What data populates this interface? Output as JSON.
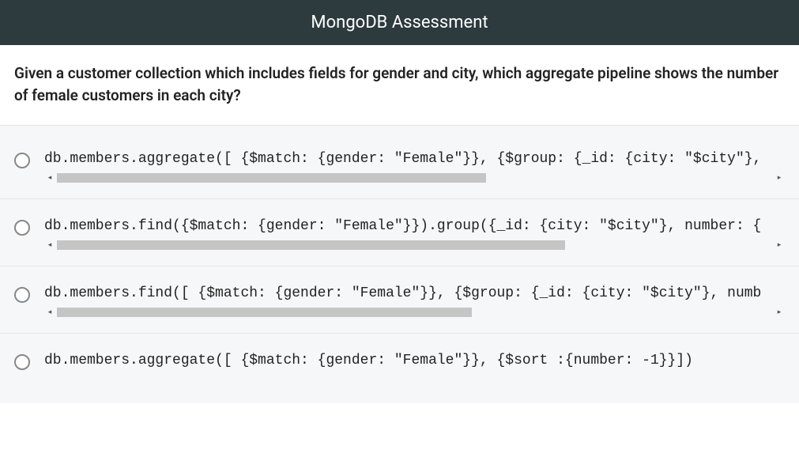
{
  "header": {
    "title": "MongoDB Assessment"
  },
  "question": {
    "text": "Given a customer collection which includes fields for gender and city, which aggregate pipeline shows the number of female customers in each city?"
  },
  "options": [
    {
      "code": "db.members.aggregate([ {$match: {gender: \"Female\"}}, {$group: {_id: {city: \"$city\"},",
      "thumbWidth": "60%",
      "hasScroll": true
    },
    {
      "code": "db.members.find({$match: {gender: \"Female\"}}).group({_id: {city: \"$city\"}, number: {",
      "thumbWidth": "71%",
      "hasScroll": true
    },
    {
      "code": "db.members.find([ {$match: {gender: \"Female\"}}, {$group: {_id: {city: \"$city\"}, numb",
      "thumbWidth": "58%",
      "hasScroll": true
    },
    {
      "code": "db.members.aggregate([ {$match: {gender: \"Female\"}}, {$sort :{number: -1}}])",
      "thumbWidth": "100%",
      "hasScroll": false
    }
  ]
}
